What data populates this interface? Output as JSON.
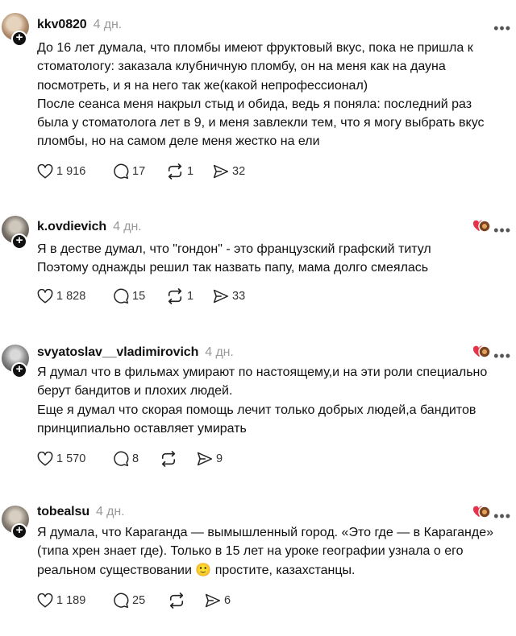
{
  "posts": [
    {
      "username": "kkv0820",
      "time": "4 дн.",
      "lines": [
        "До 16 лет думала, что пломбы имеют фруктовый вкус, пока не пришла к",
        "стоматологу: заказала клубничную пломбу, он на меня как на дауна",
        "посмотреть, и я на него так же(какой непрофессионал)",
        "После сеанса меня накрыл стыд и обида, ведь я поняла: последний раз",
        "была у стоматолога лет в 9, и меня завлекли тем, что я могу выбрать вкус",
        "пломбы, но на самом деле меня жестко на  ели"
      ],
      "likes": "1 916",
      "replies": "17",
      "reposts": "1",
      "shares": "32"
    },
    {
      "username": "k.ovdievich",
      "time": "4 дн.",
      "lines": [
        "Я в дестве думал, что \"гондон\" - это французский графский титул",
        "Поэтому однажды решил так назвать папу, мама долго смеялась"
      ],
      "likes": "1 828",
      "replies": "15",
      "reposts": "1",
      "shares": "33"
    },
    {
      "username": "svyatoslav__vladimirovich",
      "time": "4 дн.",
      "lines": [
        "Я думал что в фильмах умирают по настоящему,и на эти роли специально",
        "берут бандитов и плохих людей.",
        "Еще я думал что скорая помощь лечит только добрых людей,а бандитов",
        "принципиально оставляет умирать"
      ],
      "likes": "1 570",
      "replies": "8",
      "reposts": "",
      "shares": "9"
    },
    {
      "username": "tobealsu",
      "time": "4 дн.",
      "lines": [
        "Я думала, что Караганда — вымышленный город. «Это где — в Караганде»",
        "(типа хрен знает где). Только в 15 лет на уроке географии узнала о его",
        "реальном существовании 🙂 простите, казахстанцы."
      ],
      "likes": "1 189",
      "replies": "25",
      "reposts": "",
      "shares": "6"
    }
  ],
  "icons": {
    "like": "heart-icon",
    "reply": "comment-icon",
    "repost": "repost-icon",
    "share": "send-icon",
    "more": "more-icon",
    "follow": "plus-icon"
  },
  "more_glyph": "•••",
  "plus_glyph": "+"
}
